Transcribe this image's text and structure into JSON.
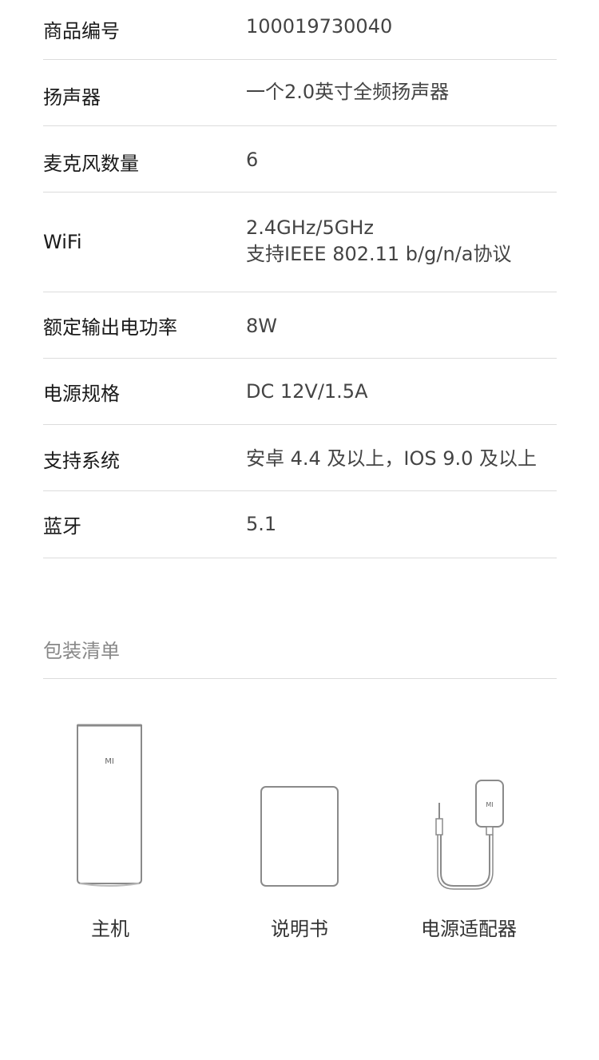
{
  "specs": [
    {
      "label": "商品编号",
      "value": "100019730040"
    },
    {
      "label": "扬声器",
      "value": "一个2.0英寸全频扬声器"
    },
    {
      "label": "麦克风数量",
      "value": "6"
    },
    {
      "label": "WiFi",
      "value": "2.4GHz/5GHz",
      "value2": "支持IEEE 802.11 b/g/n/a协议"
    },
    {
      "label": "额定输出电功率",
      "value": "8W"
    },
    {
      "label": "电源规格",
      "value": "DC 12V/1.5A"
    },
    {
      "label": "支持系统",
      "value": "安卓 4.4 及以上，IOS 9.0 及以上"
    },
    {
      "label": "蓝牙",
      "value": "5.1"
    }
  ],
  "package": {
    "title": "包装清单",
    "items": [
      {
        "name": "主机",
        "logo": "MI",
        "icon": "speaker-icon"
      },
      {
        "name": "说明书",
        "icon": "manual-icon"
      },
      {
        "name": "电源适配器",
        "logo": "MI",
        "icon": "power-adapter-icon"
      }
    ]
  },
  "colors": {
    "text": "#1a1a1a",
    "value_text": "#444444",
    "muted": "#888888",
    "divider": "#dcdcdc",
    "icon_stroke": "#8a8a8a"
  }
}
